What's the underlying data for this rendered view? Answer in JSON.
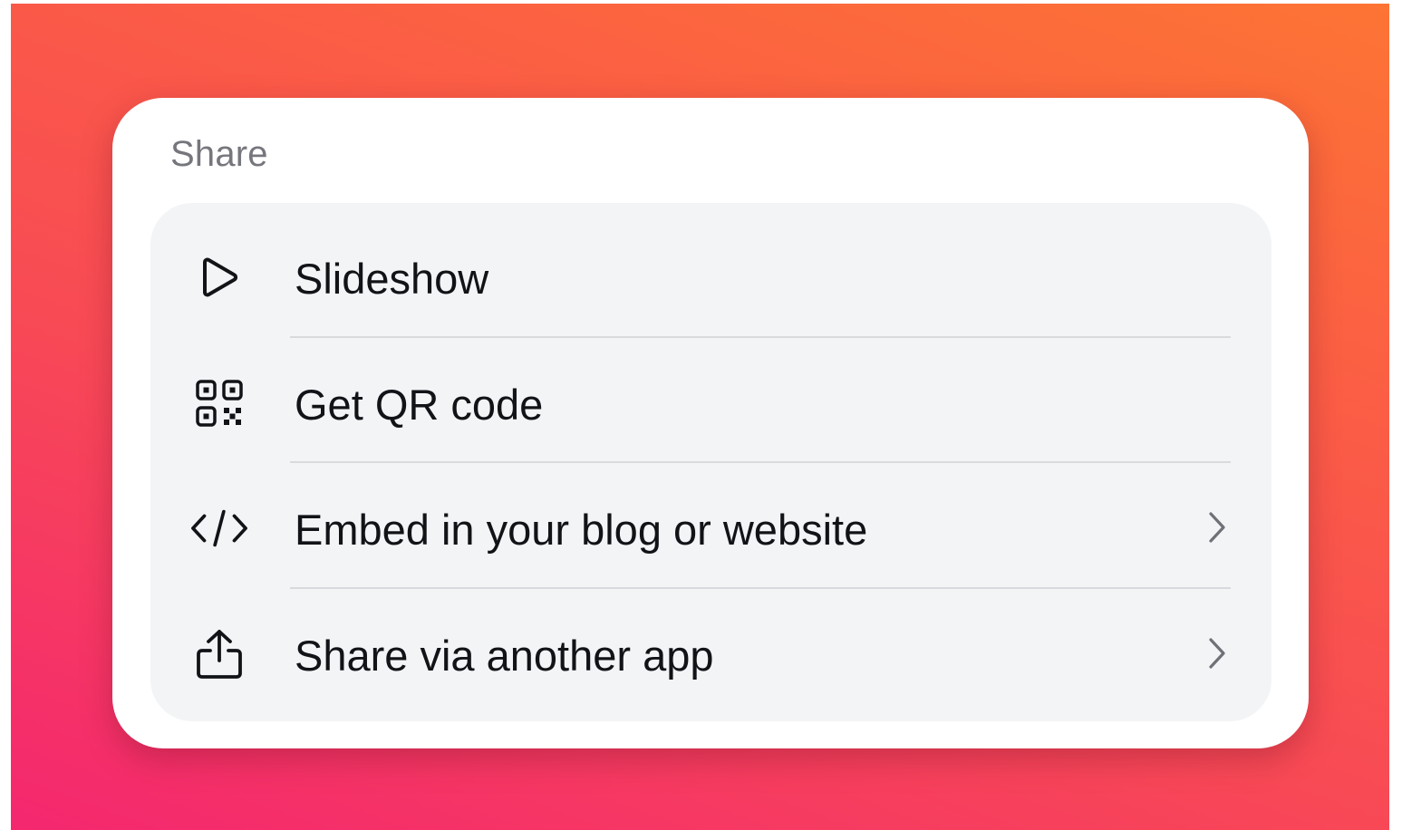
{
  "share_menu": {
    "title": "Share",
    "items": [
      {
        "label": "Slideshow",
        "icon": "play-icon",
        "has_submenu": false
      },
      {
        "label": "Get QR code",
        "icon": "qr-code-icon",
        "has_submenu": false
      },
      {
        "label": "Embed in your blog or website",
        "icon": "code-icon",
        "has_submenu": true
      },
      {
        "label": "Share via another app",
        "icon": "share-upload-icon",
        "has_submenu": true
      }
    ]
  },
  "colors": {
    "background_gradient": [
      "#f4276f",
      "#fd7434"
    ],
    "card": "#ffffff",
    "list_background": "#f3f4f6",
    "title_text": "#75777c",
    "item_text": "#111317",
    "divider": "#d9dadd"
  }
}
